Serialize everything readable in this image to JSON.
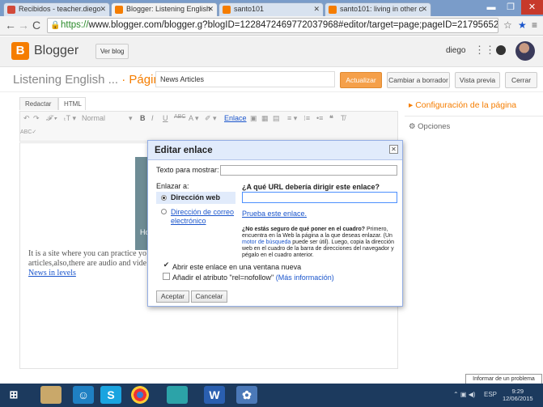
{
  "browser": {
    "tabs": [
      {
        "label": "Recibidos - teacher.diego",
        "color": "#d24a3a"
      },
      {
        "label": "Blogger: Listening English",
        "color": "#f57d00"
      },
      {
        "label": "santo101",
        "color": "#f57d00"
      },
      {
        "label": "santo101: living in other c",
        "color": "#f57d00"
      }
    ],
    "url_scheme": "https://",
    "url_rest": "www.blogger.com/blogger.g?blogID=1228472469772037968#editor/target=page;pageID=21795652705"
  },
  "header": {
    "logo_letter": "B",
    "brand": "Blogger",
    "view_blog_label": "Ver blog",
    "user": "diego"
  },
  "title_row": {
    "blog_title": "Listening English ...",
    "separator": "·",
    "page_type": "Página",
    "title_value": "News Articles",
    "publish_label": "Actualizar",
    "draft_label": "Cambiar a borrador",
    "preview_label": "Vista previa",
    "close_label": "Cerrar"
  },
  "editor": {
    "tab_compose": "Redactar",
    "tab_html": "HTML",
    "font_style": "Normal",
    "link_label": "Enlace",
    "body_text": "It is a site where you can practice yo articles,also,there are audio and vide",
    "body_link": "News in levels",
    "card_text": "Hor"
  },
  "sidebar": {
    "heading": "Configuración de la página",
    "options_label": "Opciones"
  },
  "dialog": {
    "title": "Editar enlace",
    "text_label": "Texto para mostrar:",
    "link_to_label": "Enlazar a:",
    "opt_web": "Dirección web",
    "opt_email": "Dirección de correo electrónico",
    "url_question": "¿A qué URL debería dirigir este enlace?",
    "test_link": "Prueba este enlace.",
    "help_bold": "¿No estás seguro de qué poner en el cuadro?",
    "help_1": "Primero, encuentra en la Web la página a la que deseas enlazar. (Un",
    "help_link": "motor de búsqueda",
    "help_2": "puede ser útil). Luego, copia la dirección web en el cuadro de la barra de direcciones del navegador y pégalo en el cuadro anterior.",
    "new_window_label": "Abrir este enlace en una ventana nueva",
    "nofollow_label": "Añadir el atributo \"rel=nofollow\"",
    "more_info": "(Más información)",
    "accept_label": "Aceptar",
    "cancel_label": "Cancelar"
  },
  "taskbar": {
    "lang": "ESP",
    "time": "9:29",
    "date": "12/06/2015",
    "popup": "Informar de un problema"
  }
}
